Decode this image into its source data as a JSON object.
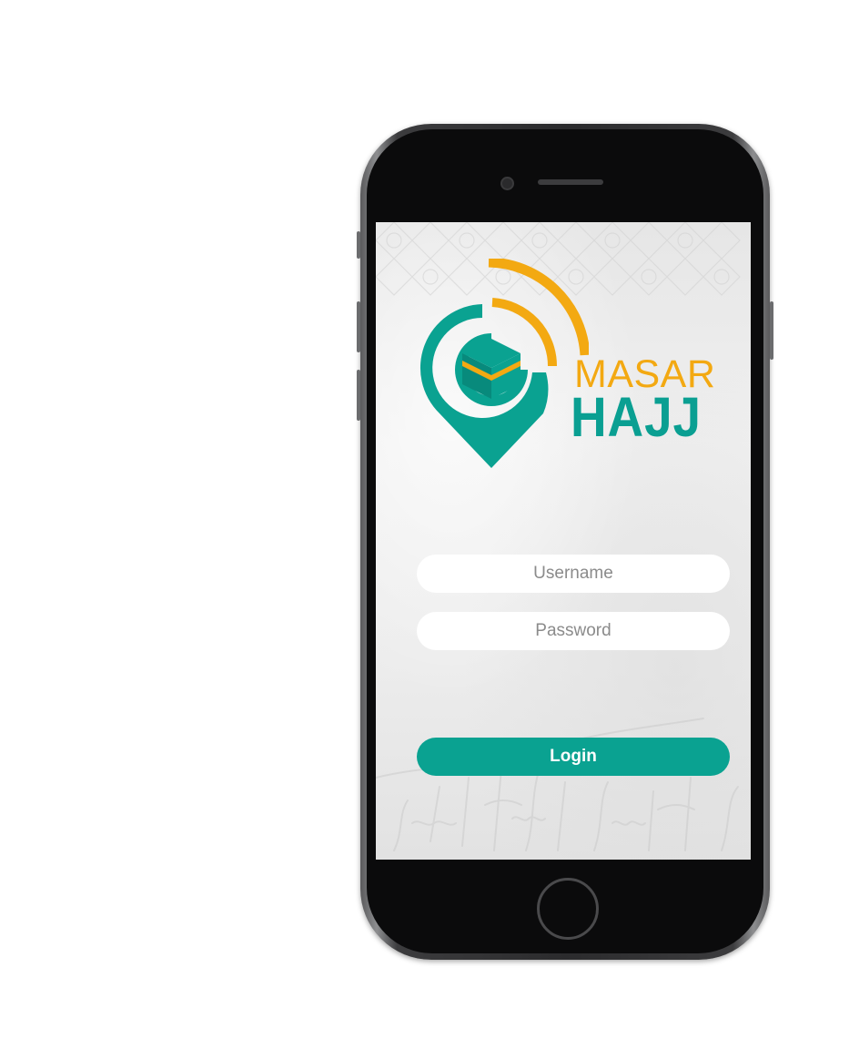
{
  "brand": {
    "line1": "MASAR",
    "line2": "HAJJ"
  },
  "form": {
    "username_placeholder": "Username",
    "password_placeholder": "Password",
    "login_label": "Login"
  },
  "colors": {
    "teal": "#0aa291",
    "gold": "#f3a912",
    "brand_teal_text": "#0a9f92",
    "field_bg": "#ffffff"
  },
  "icons": {
    "logo": "location-pin-kaaba-signal-icon"
  }
}
